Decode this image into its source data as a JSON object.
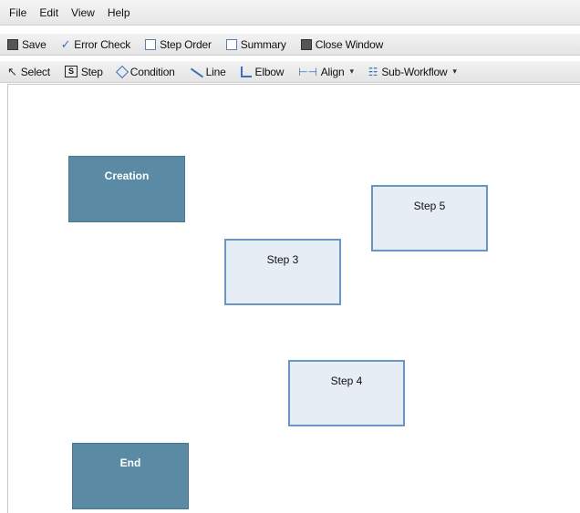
{
  "menu": {
    "items": [
      "File",
      "Edit",
      "View",
      "Help"
    ]
  },
  "toolbar1": {
    "save": "Save",
    "error_check": "Error Check",
    "step_order": "Step Order",
    "summary": "Summary",
    "close_window": "Close Window"
  },
  "toolbar2": {
    "select": "Select",
    "step": "Step",
    "condition": "Condition",
    "line": "Line",
    "elbow": "Elbow",
    "align": "Align",
    "sub_workflow": "Sub-Workflow",
    "step_icon_letter": "S"
  },
  "canvas": {
    "nodes": {
      "creation": "Creation",
      "step3": "Step 3",
      "step4": "Step 4",
      "step5": "Step 5",
      "end": "End"
    }
  },
  "colors": {
    "terminal_node": "#5b8aa5",
    "step_node_fill": "#e6edf5",
    "step_node_border": "#6a96c4"
  }
}
